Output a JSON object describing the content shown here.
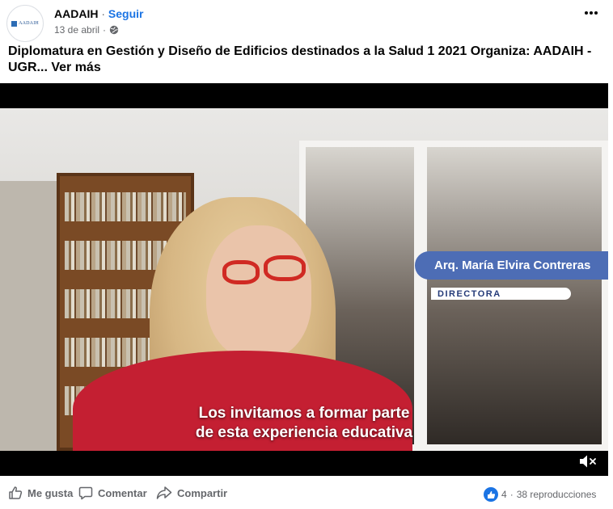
{
  "post": {
    "author": {
      "name": "AADAIH",
      "avatar_text": "AADAIH",
      "separator": "·",
      "follow_label": "Seguir"
    },
    "meta": {
      "date": "13 de abril",
      "separator": "·",
      "privacy_icon": "globe-icon"
    },
    "more_icon": "more-dots-icon",
    "text": "Diplomatura en Gestión y Diseño de Edificios destinados a la Salud 1 2021 Organiza: AADAIH - UGR...",
    "see_more_label": "Ver más"
  },
  "video": {
    "lower_third": {
      "name": "Arq. María Elvira Contreras",
      "role": "DIRECTORA"
    },
    "subtitle": {
      "line1": "Los invitamos a formar parte",
      "line2": "de esta experiencia educativa"
    },
    "mute_icon": "speaker-muted-icon"
  },
  "actions": {
    "like_label": "Me gusta",
    "comment_label": "Comentar",
    "share_label": "Compartir"
  },
  "stats": {
    "reaction_count": "4",
    "separator": "·",
    "views": "38 reproducciones"
  },
  "colors": {
    "accent": "#1b74e4",
    "lower_third_bg": "#4d6db5",
    "secondary_text": "#65676b"
  }
}
